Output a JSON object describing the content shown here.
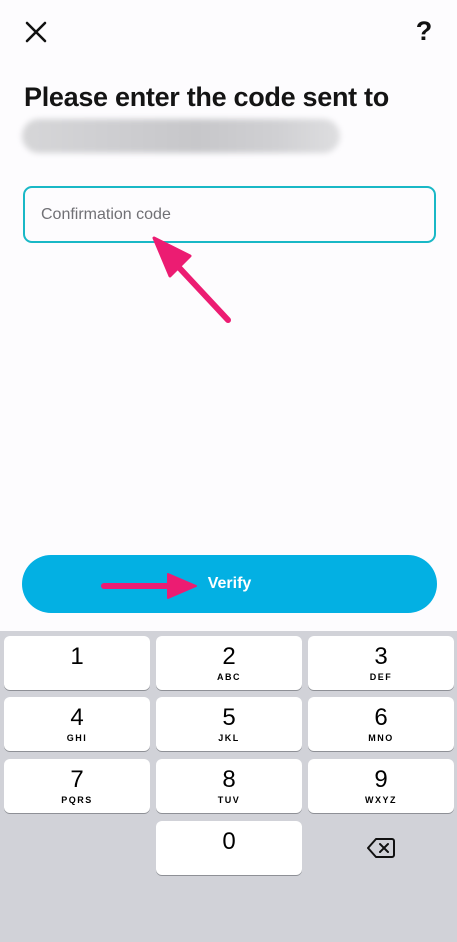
{
  "header": {
    "close_icon": "close-icon",
    "help_label": "?"
  },
  "main": {
    "title": "Please enter the code sent to",
    "code_input": {
      "placeholder": "Confirmation code",
      "value": ""
    },
    "verify_label": "Verify"
  },
  "colors": {
    "accent": "#03b0e3",
    "input_border": "#19b8c6",
    "annotation_arrow": "#ec1c72",
    "keyboard_bg": "#d1d2d8"
  },
  "keyboard": {
    "keys": [
      {
        "num": "1",
        "letters": ""
      },
      {
        "num": "2",
        "letters": "ABC"
      },
      {
        "num": "3",
        "letters": "DEF"
      },
      {
        "num": "4",
        "letters": "GHI"
      },
      {
        "num": "5",
        "letters": "JKL"
      },
      {
        "num": "6",
        "letters": "MNO"
      },
      {
        "num": "7",
        "letters": "PQRS"
      },
      {
        "num": "8",
        "letters": "TUV"
      },
      {
        "num": "9",
        "letters": "WXYZ"
      },
      {
        "num": "0",
        "letters": ""
      }
    ],
    "backspace_icon": "backspace-icon"
  }
}
